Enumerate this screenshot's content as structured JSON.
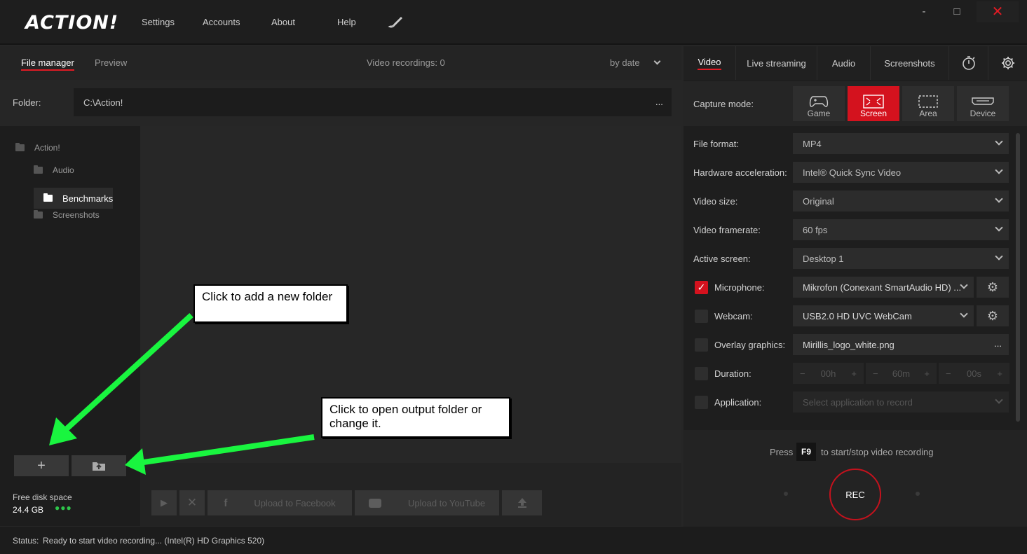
{
  "app": {
    "logo": "ACTION!"
  },
  "topmenu": {
    "settings": "Settings",
    "accounts": "Accounts",
    "about": "About",
    "help": "Help"
  },
  "window": {
    "minimize": "-",
    "maximize": "□",
    "close": "✕"
  },
  "filemanager": {
    "tabs": [
      "File manager",
      "Preview"
    ],
    "recordings": "Video recordings: 0",
    "sort": "by date",
    "folder_label": "Folder:",
    "folder_path": "C:\\Action!",
    "folder_more": "...",
    "tree": [
      "Action!",
      "Audio",
      "Benchmarks",
      "Screenshots"
    ],
    "disk_label": "Free disk space",
    "disk_value": "24.4 GB",
    "upload_facebook": "Upload to Facebook",
    "upload_youtube": "Upload to YouTube"
  },
  "callouts": {
    "add_folder": "Click to add a new folder",
    "open_folder": "Click to open output folder or change it."
  },
  "status": {
    "label": "Status:",
    "text": "Ready to start video recording... (Intel(R) HD Graphics 520)"
  },
  "rightpanel": {
    "tabs": [
      "Video",
      "Live streaming",
      "Audio",
      "Screenshots"
    ],
    "capture_label": "Capture mode:",
    "modes": [
      "Game",
      "Screen",
      "Area",
      "Device"
    ],
    "settings": [
      {
        "label": "File format:",
        "value": "MP4"
      },
      {
        "label": "Hardware acceleration:",
        "value": "Intel® Quick Sync Video"
      },
      {
        "label": "Video size:",
        "value": "Original"
      },
      {
        "label": "Video framerate:",
        "value": "60 fps"
      },
      {
        "label": "Active screen:",
        "value": "Desktop 1"
      }
    ],
    "microphone": {
      "label": "Microphone:",
      "value": "Mikrofon (Conexant SmartAudio HD)  ..."
    },
    "webcam": {
      "label": "Webcam:",
      "value": "USB2.0 HD UVC WebCam"
    },
    "overlay": {
      "label": "Overlay graphics:",
      "value": "Mirillis_logo_white.png",
      "more": "..."
    },
    "duration": {
      "label": "Duration:",
      "h": "00h",
      "m": "60m",
      "s": "00s"
    },
    "application": {
      "label": "Application:",
      "placeholder": "Select application to record"
    },
    "hotkey": {
      "press": "Press",
      "key": "F9",
      "text": "to start/stop video recording"
    },
    "rec": "REC"
  },
  "colors": {
    "accent": "#d4121e",
    "arrow": "#19f53f"
  }
}
